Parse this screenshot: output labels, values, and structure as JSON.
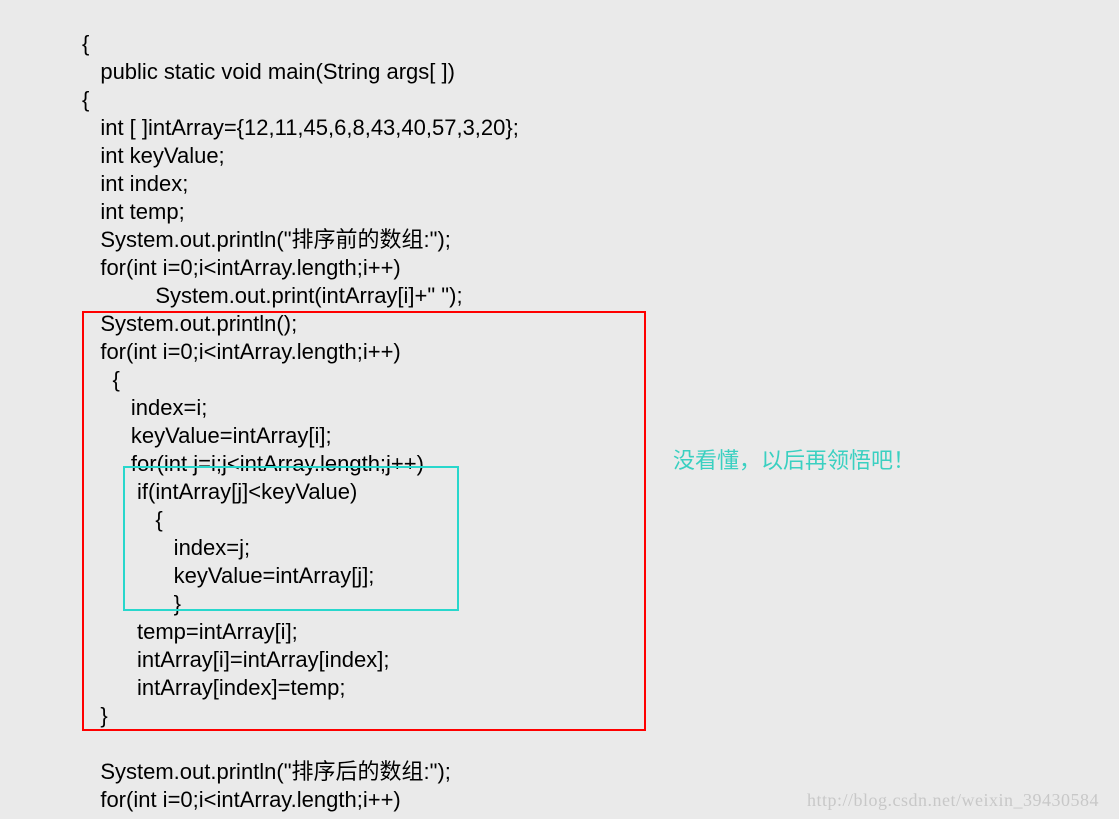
{
  "code": {
    "l1": "{",
    "l2": "   public static void main(String args[ ])",
    "l3": "{",
    "l4": "   int [ ]intArray={12,11,45,6,8,43,40,57,3,20};",
    "l5": "   int keyValue;",
    "l6": "   int index;",
    "l7": "   int temp;",
    "l8": "   System.out.println(\"排序前的数组:\");",
    "l9": "   for(int i=0;i<intArray.length;i++)",
    "l10": "            System.out.print(intArray[i]+\" \");",
    "l11": "   System.out.println();",
    "l12": "   for(int i=0;i<intArray.length;i++)",
    "l13": "     {",
    "l14": "        index=i;",
    "l15": "        keyValue=intArray[i];",
    "l16": "        for(int j=i;j<intArray.length;j++)",
    "l17": "         if(intArray[j]<keyValue)",
    "l18": "            {",
    "l19": "               index=j;",
    "l20": "               keyValue=intArray[j];",
    "l21": "               }",
    "l22": "         temp=intArray[i];",
    "l23": "         intArray[i]=intArray[index];",
    "l24": "         intArray[index]=temp;",
    "l25": "   }",
    "l26": "",
    "l27": "   System.out.println(\"排序后的数组:\");",
    "l28": "   for(int i=0;i<intArray.length;i++)"
  },
  "annotation": "没看懂，以后再领悟吧！",
  "watermark": "http://blog.csdn.net/weixin_39430584"
}
